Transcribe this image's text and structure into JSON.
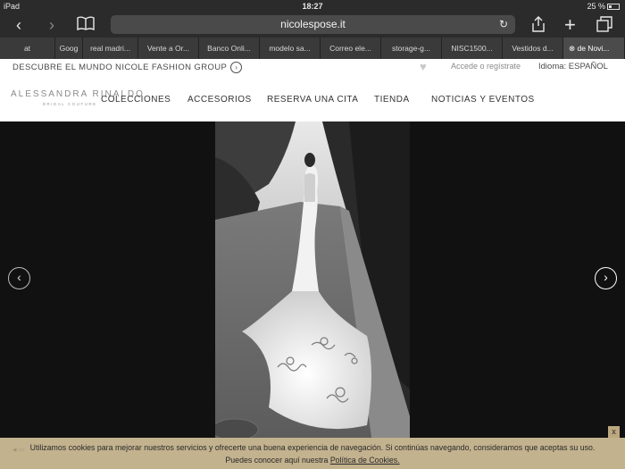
{
  "status": {
    "device": "iPad",
    "time": "18:27",
    "battery": "25 %"
  },
  "browser": {
    "url": "nicolespose.it",
    "tabs": [
      "at",
      "Goog",
      "real madri...",
      "Vente a Or...",
      "Banco Onli...",
      "modelo sa...",
      "Correo ele...",
      "storage-g...",
      "NISC1500...",
      "Vestidos d...",
      "de Novi..."
    ]
  },
  "site": {
    "group_link": "DESCUBRE EL MUNDO NICOLE FASHION GROUP",
    "login": "Accede o regístrate",
    "language": "Idioma: ESPAÑOL",
    "brand": "ALESSANDRA RINALDO",
    "brand_sub": "BRIDAL COUTURE",
    "menu": [
      "COLECCIONES",
      "ACCESORIOS",
      "RESERVA UNA CITA",
      "TIENDA",
      "NOTICIAS Y EVENTOS"
    ]
  },
  "cookie": {
    "line1": "Utilizamos cookies para mejorar nuestros servicios y ofrecerte una buena experiencia de navegación. Si continúas navegando, consideramos que aceptas su uso.",
    "line2_prefix": "Puedes conocer aquí nuestra",
    "link": "Política de Cookies.",
    "close": "x"
  },
  "icons": {
    "back": "chevron-left-icon",
    "forward": "chevron-right-icon",
    "bookmarks": "book-icon",
    "reload": "reload-icon",
    "share": "share-icon",
    "new_tab": "plus-icon",
    "tabs": "tabs-icon",
    "prev": "arrow-left-circle-icon",
    "next": "arrow-right-circle-icon",
    "heart": "heart-icon"
  }
}
